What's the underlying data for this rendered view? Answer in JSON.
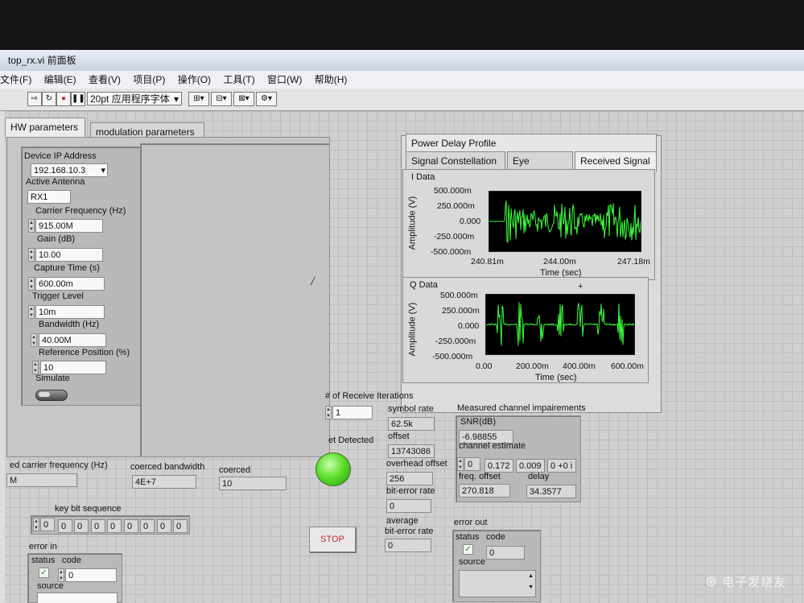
{
  "window": {
    "title": "top_rx.vi 前面板"
  },
  "menu": [
    "文件(F)",
    "编辑(E)",
    "查看(V)",
    "项目(P)",
    "操作(O)",
    "工具(T)",
    "窗口(W)",
    "帮助(H)"
  ],
  "toolbar": {
    "font_selector": "20pt 应用程序字体"
  },
  "left_tabs": [
    "HW parameters",
    "modulation parameters"
  ],
  "hw": {
    "device_ip_label": "Device IP Address",
    "device_ip_value": "192.168.10.3",
    "antenna_label": "Active Antenna",
    "antenna_value": "RX1",
    "carrier_label": "Carrier Frequency (Hz)",
    "carrier_value": "915.00M",
    "gain_label": "Gain (dB)",
    "gain_value": "10.00",
    "capture_label": "Capture Time (s)",
    "capture_value": "600.00m",
    "trigger_label": "Trigger Level",
    "trigger_value": "10m",
    "bandwidth_label": "Bandwidth (Hz)",
    "bandwidth_value": "40.00M",
    "refpos_label": "Reference Position (%)",
    "refpos_value": "10",
    "simulate_label": "Simulate"
  },
  "right_tabs": {
    "top": "Power Delay Profile",
    "row": [
      "Signal Constellation",
      "Eye Diagram",
      "Received Signal"
    ]
  },
  "idata": {
    "title": "I Data",
    "ylabel": "Amplitude (V)",
    "xlabel": "Time (sec)",
    "yticks": [
      "500.000m",
      "250.000m",
      "0.000",
      "-250.000m",
      "-500.000m"
    ],
    "xticks": [
      "240.81m",
      "244.00m",
      "247.18m"
    ]
  },
  "qdata": {
    "title": "Q Data",
    "ylabel": "Amplitude (V)",
    "xlabel": "Time (sec)",
    "yticks": [
      "500.000m",
      "250.000m",
      "0.000",
      "-250.000m",
      "-500.000m"
    ],
    "xticks": [
      "0.00",
      "200.00m",
      "400.00m",
      "600.00m"
    ]
  },
  "iterations": {
    "label": "# of Receive Iterations",
    "value": "1"
  },
  "stats": {
    "symbol_rate_label": "symbol rate",
    "symbol_rate_value": "62.5k",
    "offset_label": "offset",
    "offset_value": "13743086",
    "overhead_label": "overhead offset",
    "overhead_value": "256",
    "ber_label": "bit-error rate",
    "ber_value": "0",
    "avg_ber_label1": "average",
    "avg_ber_label2": "bit-error rate",
    "avg_ber_value": "0"
  },
  "detected": {
    "label": "et Detected"
  },
  "impairments": {
    "title": "Measured channel impairements",
    "snr_label": "SNR(dB)",
    "snr_value": "-6.98855",
    "chest_label": "channel estimate",
    "chest_index": "0",
    "chest_v1": "0.172",
    "chest_v2": "0.009",
    "chest_v3": "0 +0 i",
    "freq_label": "freq. offset",
    "freq_value": "270.818",
    "delay_label": "delay",
    "delay_value": "34.3577"
  },
  "coerced": {
    "carrier_label": "ed carrier frequency (Hz)",
    "carrier_value": "M",
    "bw_label": "coerced bandwidth",
    "bw_value": "4E+7",
    "coerced_label": "coerced",
    "coerced_value": "10"
  },
  "keybits": {
    "label": "key bit sequence",
    "index": "0",
    "bits": [
      "0",
      "0",
      "0",
      "0",
      "0",
      "0",
      "0",
      "0"
    ]
  },
  "error_in": {
    "title": "error in",
    "status_label": "status",
    "code_label": "code",
    "code_value": "0",
    "source_label": "source",
    "check": "✓"
  },
  "error_out": {
    "title": "error out",
    "status_label": "status",
    "code_label": "code",
    "code_value": "0",
    "source_label": "source",
    "check": "✓"
  },
  "stop": {
    "label": "STOP"
  },
  "watermark": "电子发烧友",
  "icons": {
    "stop_color": "#c03030",
    "led_color": "#5fe02a",
    "trace_color": "#3cff3c"
  }
}
